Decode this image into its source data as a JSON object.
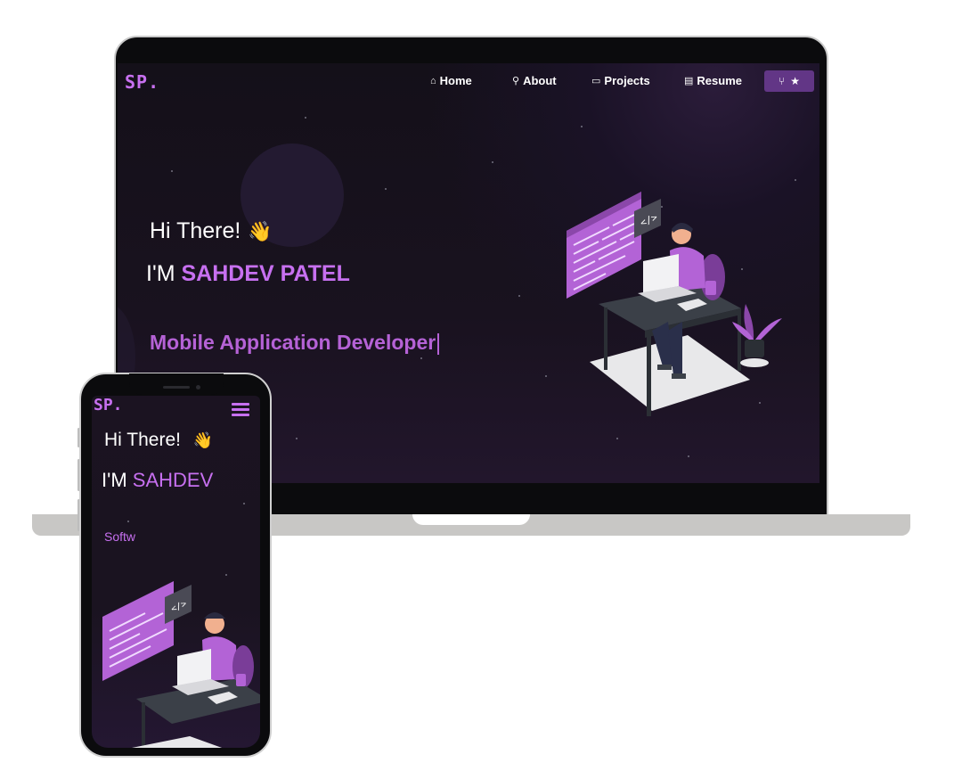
{
  "site": {
    "logo": "SP."
  },
  "nav": {
    "items": [
      {
        "label": "Home",
        "icon": "home-icon"
      },
      {
        "label": "About",
        "icon": "user-icon"
      },
      {
        "label": "Projects",
        "icon": "projects-icon"
      },
      {
        "label": "Resume",
        "icon": "resume-icon"
      }
    ],
    "fork_star_icons": [
      "fork-icon",
      "star-icon"
    ]
  },
  "hero": {
    "greeting": "Hi There!",
    "wave_emoji": "👋",
    "name_prefix": "I'M",
    "name": "SAHDEV PATEL",
    "role": "Mobile Application Developer"
  },
  "mobile": {
    "logo": "SP.",
    "greeting": "Hi There!",
    "name_prefix": "I'M",
    "name": "SAHDEV",
    "role_partial": "Softw"
  },
  "colors": {
    "accent": "#c770f0",
    "role_text": "#b562d6",
    "fork_button": "#623686",
    "background": "#141019"
  }
}
